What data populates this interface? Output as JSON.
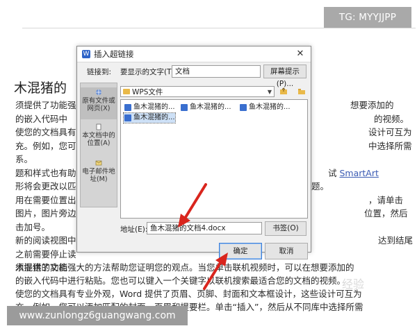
{
  "watermarks": {
    "tg": "TG: MYYJJPP",
    "url": "www.zunlongz6guangwang.com",
    "corner": "经验"
  },
  "document": {
    "title": "木混猪的",
    "left_lines": [
      "须提供了功能强",
      "的嵌入代码中",
      "使您的文档具有",
      "充。例如，您可",
      "系。",
      "题和样式也有助",
      "形将会更改以匹",
      "用在需要位置出",
      "图片，图片旁边",
      "击加号。",
      "新的阅读视图中",
      "之前需要停止读"
    ],
    "right_lines": [
      "想要添加的",
      "的视频。",
      "设计可互为",
      "中选择所需",
      "",
      "SmartArt",
      "题。",
      "，请单击",
      "位置，然后",
      "",
      "达到结尾",
      ""
    ],
    "right_prefix_smartart": "试",
    "subtitle": "木混猪的文档",
    "bottom_lines": [
      "须提供了功能强大的方法帮助您证明您的观点。当您单击联机视频时，可以在想要添加的",
      "的嵌入代码中进行粘贴。您也可以键入一个关键字以联机搜索最适合您的文档的视频。",
      "使您的文档具有专业外观，Word 提供了页眉、页脚、封面和文本框设计，这些设计可互为",
      "充。例如，您可以添加匹配的封面、页眉和提要栏。单击“插入”，然后从不同库中选择所需"
    ]
  },
  "dialog": {
    "title": "插入超链接",
    "link_to_label": "链接到:",
    "display_text_label": "要显示的文字(T):",
    "display_text_value": "文档",
    "screen_tip_button": "屏幕提示(P)...",
    "nav": [
      {
        "label": "原有文件或网页(X)",
        "selected": true
      },
      {
        "label": "本文档中的位置(A)",
        "selected": false
      },
      {
        "label": "电子邮件地址(M)",
        "selected": false
      }
    ],
    "folder": "WPS文件",
    "files": [
      {
        "name": "鱼木混猪的...",
        "selected": false
      },
      {
        "name": "鱼木混猪的...",
        "selected": false
      },
      {
        "name": "鱼木混猪的...",
        "selected": false
      },
      {
        "name": "鱼木混猪的...",
        "selected": true
      }
    ],
    "address_label": "地址(E):",
    "address_value": "鱼木混猪的文档4.docx",
    "bookmark_button": "书签(O)",
    "ok_button": "确定",
    "cancel_button": "取消"
  },
  "colors": {
    "accent": "#2e64c8",
    "arrow": "#d9251d"
  }
}
